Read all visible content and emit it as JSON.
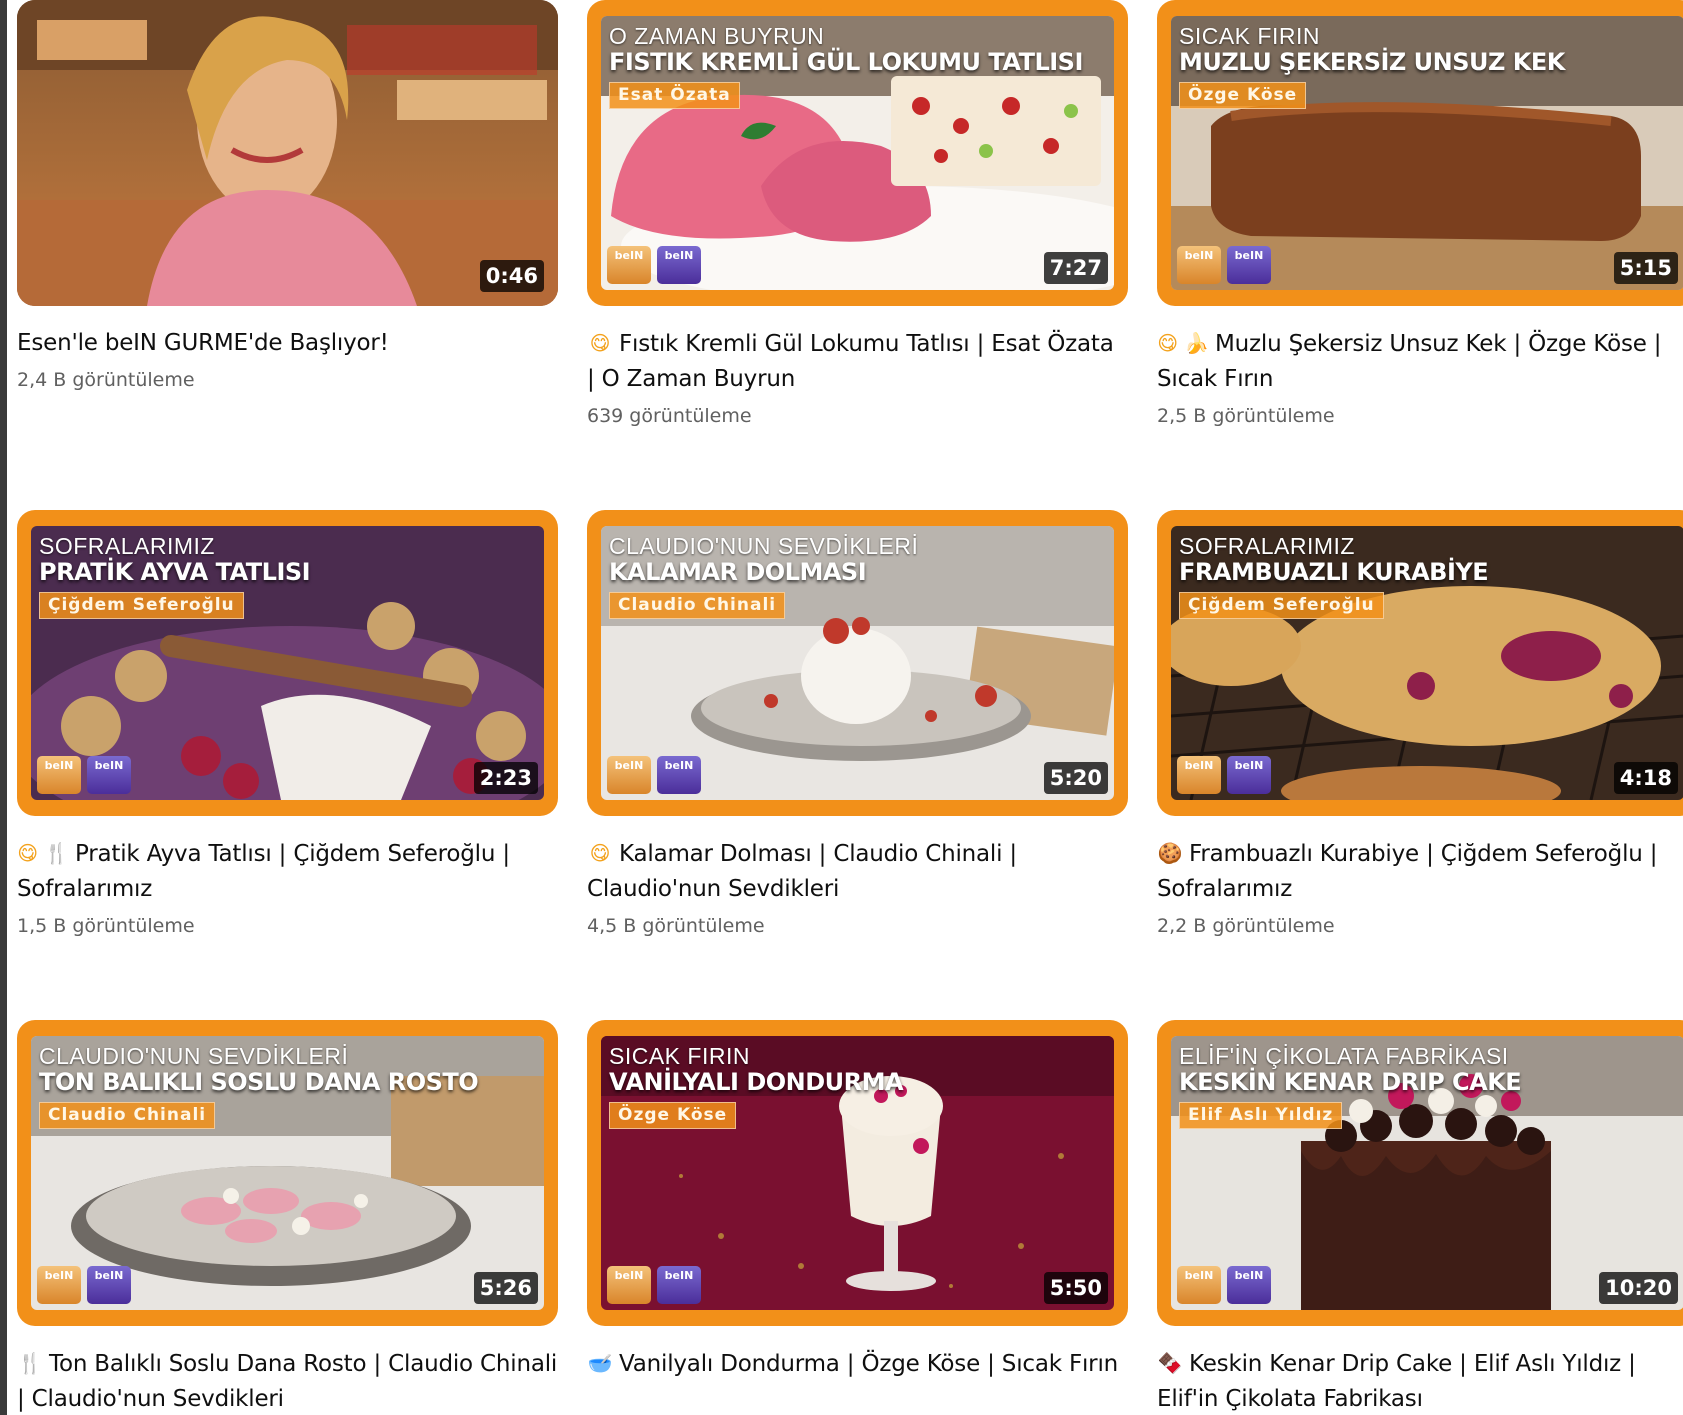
{
  "videos": [
    {
      "duration": "0:46",
      "title_emoji": "",
      "title": "Esen'le beIN GURME'de Başlıyor!",
      "views": "2,4 B görüntüleme",
      "thumb": {
        "show": "",
        "headline": "",
        "host": ""
      }
    },
    {
      "duration": "7:27",
      "title_emoji": "😋",
      "title": "Fıstık Kremli Gül Lokumu Tatlısı | Esat Özata | O Zaman Buyrun",
      "views": "639 görüntüleme",
      "thumb": {
        "show": "O ZAMAN BUYRUN",
        "headline": "FISTIK KREMLİ GÜL LOKUMU TATLISI",
        "host": "Esat Özata"
      }
    },
    {
      "duration": "5:15",
      "title_emoji": "😋 🍌",
      "title": "Muzlu Şekersiz Unsuz Kek | Özge Köse | Sıcak Fırın",
      "views": "2,5 B görüntüleme",
      "thumb": {
        "show": "SICAK FIRIN",
        "headline": "MUZLU ŞEKERSİZ UNSUZ KEK",
        "host": "Özge Köse"
      }
    },
    {
      "duration": "2:23",
      "title_emoji": "😋 🍴",
      "title": "Pratik Ayva Tatlısı | Çiğdem Seferoğlu | Sofralarımız",
      "views": "1,5 B görüntüleme",
      "thumb": {
        "show": "SOFRALARIMIZ",
        "headline": "PRATİK AYVA TATLISI",
        "host": "Çiğdem Seferoğlu"
      }
    },
    {
      "duration": "5:20",
      "title_emoji": "😋",
      "title": "Kalamar Dolması | Claudio Chinali | Claudio'nun Sevdikleri",
      "views": "4,5 B görüntüleme",
      "thumb": {
        "show": "CLAUDIO'NUN SEVDİKLERİ",
        "headline": "KALAMAR DOLMASI",
        "host": "Claudio Chinali"
      }
    },
    {
      "duration": "4:18",
      "title_emoji": "🍪",
      "title": "Frambuazlı Kurabiye | Çiğdem Seferoğlu | Sofralarımız",
      "views": "2,2 B görüntüleme",
      "thumb": {
        "show": "SOFRALARIMIZ",
        "headline": "FRAMBUAZLI KURABİYE",
        "host": "Çiğdem Seferoğlu"
      }
    },
    {
      "duration": "5:26",
      "title_emoji": "🍴",
      "title": "Ton Balıklı Soslu Dana Rosto | Claudio Chinali | Claudio'nun Sevdikleri",
      "views": "",
      "thumb": {
        "show": "CLAUDIO'NUN SEVDİKLERİ",
        "headline": "TON BALIKLI SOSLU DANA ROSTO",
        "host": "Claudio Chinali"
      }
    },
    {
      "duration": "5:50",
      "title_emoji": "🥣",
      "title": "Vanilyalı Dondurma | Özge Köse | Sıcak Fırın",
      "views": "",
      "thumb": {
        "show": "SICAK FIRIN",
        "headline": "VANİLYALI DONDURMA",
        "host": "Özge Köse"
      }
    },
    {
      "duration": "10:20",
      "title_emoji": "🍫",
      "title": "Keskin Kenar Drip Cake | Elif Aslı Yıldız | Elif'in Çikolata Fabrikası",
      "views": "",
      "thumb": {
        "show": "ELİF'İN ÇİKOLATA FABRİKASI",
        "headline": "KESKİN KENAR DRIP CAKE",
        "host": "Elif Aslı Yıldız"
      }
    }
  ],
  "logos": {
    "first": "beIN",
    "second": "beIN"
  },
  "colors": {
    "thumb_frame": "#f29019",
    "title_text": "#0f0f0f",
    "meta_text": "#606060"
  }
}
